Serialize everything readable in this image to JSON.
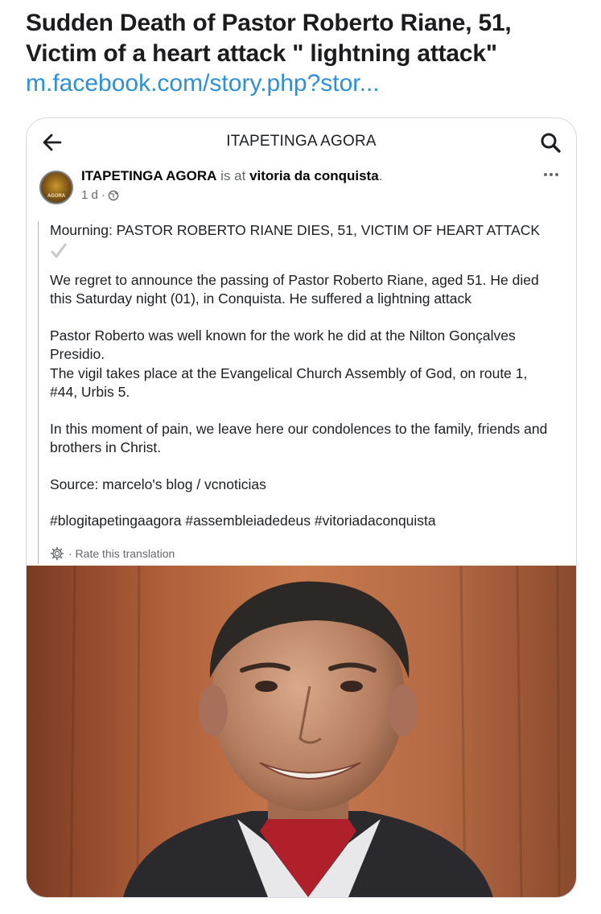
{
  "headline": {
    "line1": "Sudden Death of Pastor Roberto Riane, 51,",
    "line2": "Victim of a heart attack \" lightning attack\"",
    "link": "m.facebook.com/story.php?stor..."
  },
  "card": {
    "topbar": {
      "back_icon": "arrow-left-icon",
      "title": "ITAPETINGA AGORA",
      "search_icon": "search-icon"
    },
    "post": {
      "page_name": "ITAPETINGA AGORA",
      "is_at": " is at ",
      "place": "vitoria da conquista",
      "place_end": ".",
      "time": "1 d ·",
      "avatar_text": "AGORA",
      "more_icon": "more-horizontal-icon",
      "body": {
        "title_line": "Mourning: PASTOR ROBERTO RIANE DIES, 51, VICTIM OF HEART ATTACK",
        "p1": "We regret to announce the passing of Pastor Roberto Riane, aged 51. He died this Saturday night (01), in Conquista. He suffered a lightning attack",
        "p2": "Pastor Roberto was well known for the work he did at the Nilton Gonçalves Presidio.",
        "p3": "The vigil takes place at the Evangelical Church Assembly of God, on route 1, #44, Urbis 5.",
        "p4": "In this moment of pain, we leave here our condolences to the family, friends and brothers in Christ.",
        "p5": "Source: marcelo's blog / vcnoticias",
        "p6": "#blogitapetingaagora #assembleiadedeus #vitoriadaconquista"
      },
      "rate_translation": "· Rate this translation"
    },
    "photo_icon": "portrait-photo"
  }
}
